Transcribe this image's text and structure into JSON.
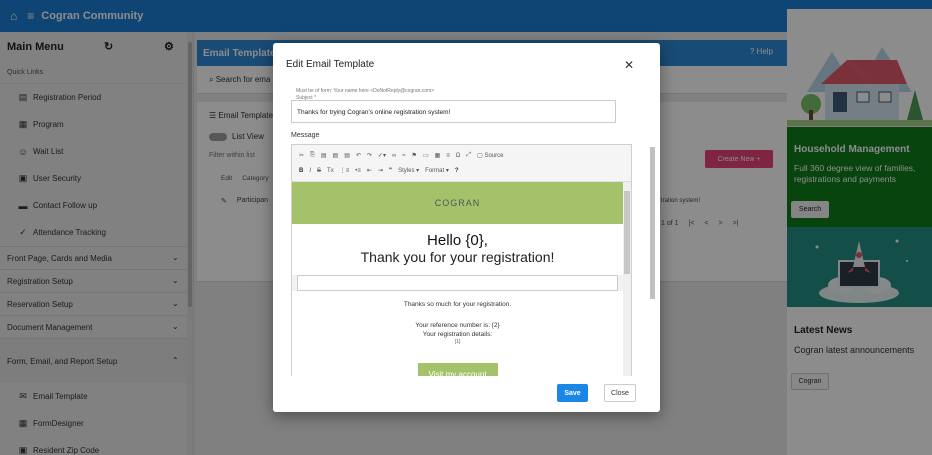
{
  "topbar": {
    "title": "Cogran Community"
  },
  "sidebar": {
    "title": "Main Menu",
    "quick_links": "Quick Links",
    "items": [
      {
        "label": "Registration Period"
      },
      {
        "label": "Program"
      },
      {
        "label": "Wait List"
      },
      {
        "label": "User Security"
      },
      {
        "label": "Contact Follow up"
      },
      {
        "label": "Attendance Tracking"
      }
    ],
    "sections": [
      {
        "label": "Front Page, Cards and Media"
      },
      {
        "label": "Registration Setup"
      },
      {
        "label": "Reservation Setup"
      },
      {
        "label": "Document Management"
      },
      {
        "label": "Form, Email, and Report Setup"
      }
    ],
    "sub_items": [
      {
        "label": "Email Template"
      },
      {
        "label": "FormDesigner"
      },
      {
        "label": "Resident Zip Code"
      }
    ]
  },
  "main": {
    "title": "Email Template",
    "help": "Help",
    "search_placeholder": "Search for ema",
    "panel_title": "Email Template",
    "list_view": "List View",
    "filter": "Filter within list",
    "col_edit": "Edit",
    "col_category": "Category",
    "row_category": "Participan",
    "row_text": "tration system!",
    "create_new": "Create New",
    "pager_text": "1 of 1"
  },
  "modal": {
    "title": "Edit Email Template",
    "hint": "Must be of form: Your name here <DoNotReply@cogran.com>",
    "subject_label": "Subject *",
    "subject_value": "Thanks for trying Cogran's online registration system!",
    "message_label": "Message",
    "toolbar": {
      "source": "Source",
      "styles": "Styles",
      "format": "Format"
    },
    "email": {
      "logo": "COGRAN",
      "hello": "Hello {0},",
      "thanks": "Thank you for your registration!",
      "p1": "Thanks so much for your registration.",
      "p2": "Your reference number is: {2}",
      "p3": "Your registration details:",
      "p4": "{1}",
      "visit": "Visit my account"
    },
    "save": "Save",
    "close": "Close"
  },
  "right": {
    "household_title": "Household Management",
    "household_text": "Full 360 degree view of families, registrations and payments",
    "search_btn": "Search",
    "news_title": "Latest News",
    "news_text": "Cogran latest announcements",
    "news_btn": "Cogran"
  }
}
